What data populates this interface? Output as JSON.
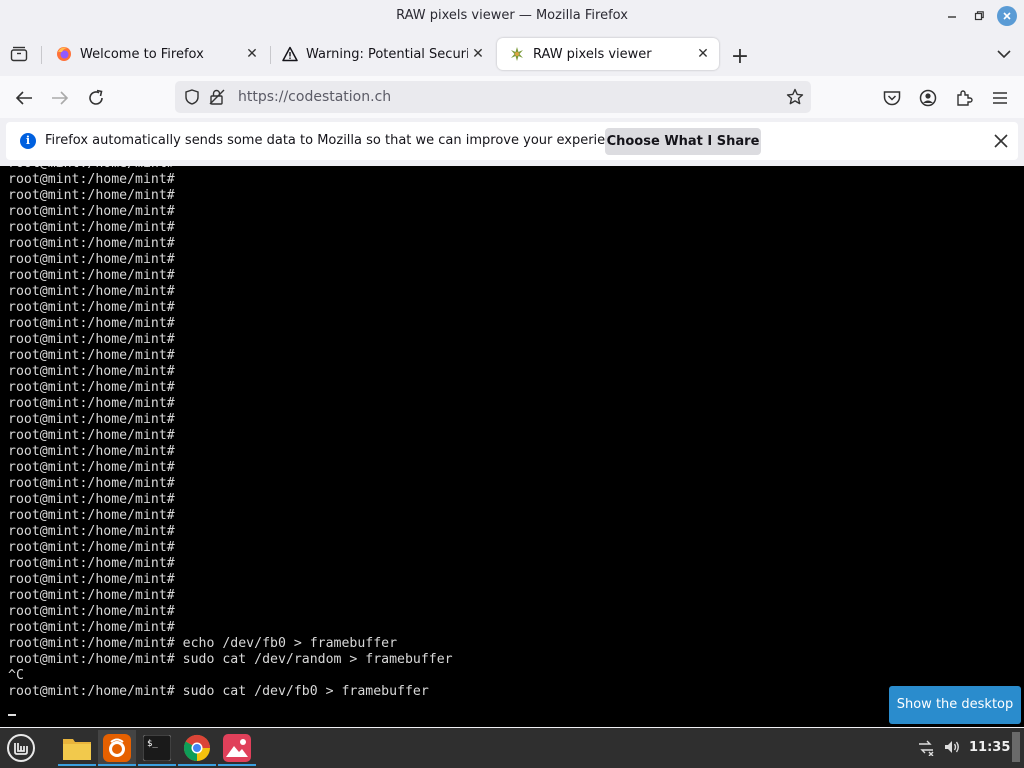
{
  "window": {
    "title": "RAW pixels viewer — Mozilla Firefox"
  },
  "tabs": [
    {
      "label": "Welcome to Firefox",
      "icon": "firefox-icon",
      "active": false
    },
    {
      "label": "Warning: Potential Security",
      "icon": "warning-icon",
      "active": false
    },
    {
      "label": "RAW pixels viewer",
      "icon": "site-favicon",
      "active": true
    }
  ],
  "navbar": {
    "url": "https://codestation.ch"
  },
  "notification": {
    "message": "Firefox automatically sends some data to Mozilla so that we can improve your experience.",
    "button": "Choose What I Share"
  },
  "terminal": {
    "lines": [
      "root@mint:/home/mint#",
      "root@mint:/home/mint#",
      "root@mint:/home/mint#",
      "root@mint:/home/mint#",
      "root@mint:/home/mint#",
      "root@mint:/home/mint#",
      "root@mint:/home/mint#",
      "root@mint:/home/mint#",
      "root@mint:/home/mint#",
      "root@mint:/home/mint#",
      "root@mint:/home/mint#",
      "root@mint:/home/mint#",
      "root@mint:/home/mint#",
      "root@mint:/home/mint#",
      "root@mint:/home/mint#",
      "root@mint:/home/mint#",
      "root@mint:/home/mint#",
      "root@mint:/home/mint#",
      "root@mint:/home/mint#",
      "root@mint:/home/mint#",
      "root@mint:/home/mint#",
      "root@mint:/home/mint#",
      "root@mint:/home/mint#",
      "root@mint:/home/mint#",
      "root@mint:/home/mint#",
      "root@mint:/home/mint#",
      "root@mint:/home/mint#",
      "root@mint:/home/mint#",
      "root@mint:/home/mint#",
      "root@mint:/home/mint#",
      "root@mint:/home/mint# echo /dev/fb0 > framebuffer",
      "root@mint:/home/mint# sudo cat /dev/random > framebuffer",
      "^C",
      "root@mint:/home/mint# sudo cat /dev/fb0 > framebuffer"
    ]
  },
  "overlay": {
    "show_desktop": "Show the desktop"
  },
  "taskbar": {
    "apps": [
      "mint-menu-icon",
      "files-icon",
      "firefox-icon",
      "terminal-icon",
      "chromium-icon",
      "image-viewer-icon"
    ],
    "clock": "11:35"
  }
}
